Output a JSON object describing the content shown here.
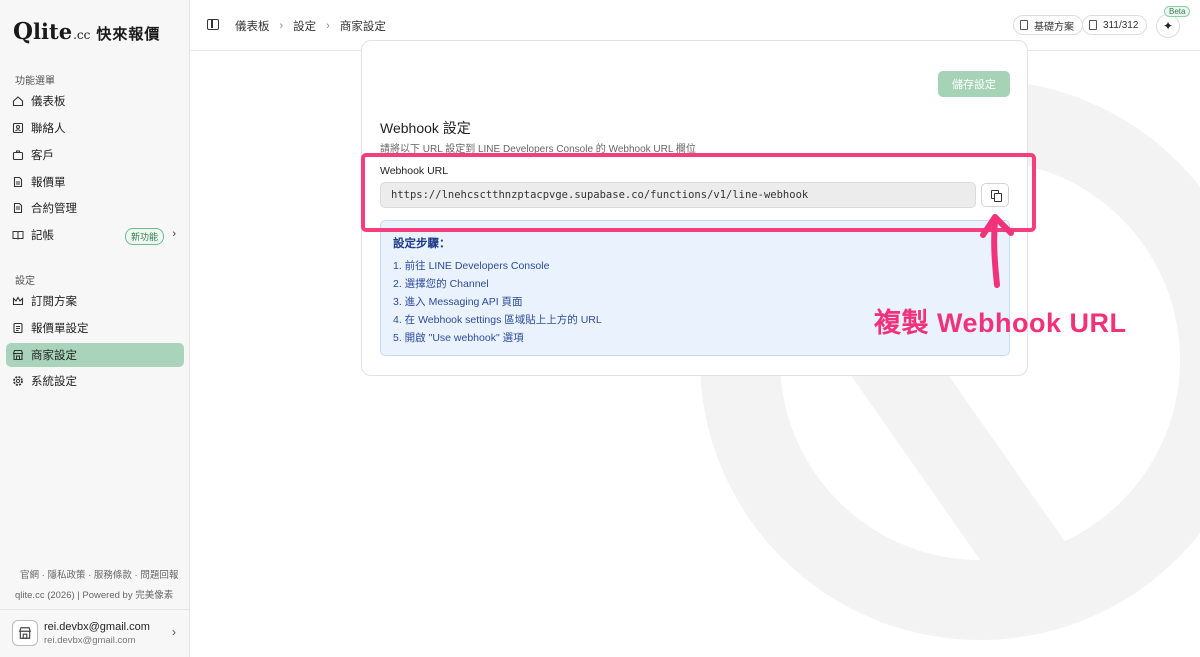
{
  "brand": {
    "logo_q": "Q",
    "logo_rest": "lite",
    "logo_cc": ".cc",
    "name_zh": "快來報價"
  },
  "sidebar": {
    "section_menu": "功能選單",
    "menu_items": [
      {
        "label": "儀表板",
        "icon": "home-icon"
      },
      {
        "label": "聯絡人",
        "icon": "contact-card-icon"
      },
      {
        "label": "客戶",
        "icon": "briefcase-icon"
      },
      {
        "label": "報價單",
        "icon": "document-icon"
      },
      {
        "label": "合約管理",
        "icon": "contract-icon"
      },
      {
        "label": "記帳",
        "icon": "book-icon",
        "badge": "新功能"
      }
    ],
    "section_settings": "設定",
    "settings_items": [
      {
        "label": "訂閱方案",
        "icon": "crown-icon"
      },
      {
        "label": "報價單設定",
        "icon": "document-settings-icon"
      },
      {
        "label": "商家設定",
        "icon": "store-icon",
        "active": true
      },
      {
        "label": "系統設定",
        "icon": "gear-icon"
      }
    ],
    "footer_links": "官網 · 隱私政策 · 服務條款 · 問題回報",
    "footer_copy": "qlite.cc (2026) | Powered by 完美像素",
    "user": {
      "name": "rei.devbx@gmail.com",
      "email": "rei.devbx@gmail.com"
    }
  },
  "header": {
    "breadcrumbs": [
      "儀表板",
      "設定",
      "商家設定"
    ],
    "plan_label": "基礎方案",
    "quota_label": "311/312",
    "beta_label": "Beta"
  },
  "main": {
    "save_button": "儲存設定",
    "webhook_title": "Webhook 設定",
    "webhook_desc": "請將以下 URL 設定到 LINE Developers Console 的 Webhook URL 欄位",
    "webhook_url_label": "Webhook URL",
    "webhook_url": "https://lnehcsctthnzptacpvge.supabase.co/functions/v1/line-webhook",
    "steps_title": "設定步驟：",
    "steps": [
      "1. 前往 LINE Developers Console",
      "2. 選擇您的 Channel",
      "3. 進入 Messaging API 頁面",
      "4. 在 Webhook settings 區域貼上上方的 URL",
      "5. 開啟 \"Use webhook\" 選項"
    ],
    "annotation": "複製 Webhook URL",
    "colors": {
      "accent": "#a9d4bb",
      "highlight": "#f43f7c",
      "info_bg": "#eaf3fd"
    }
  }
}
